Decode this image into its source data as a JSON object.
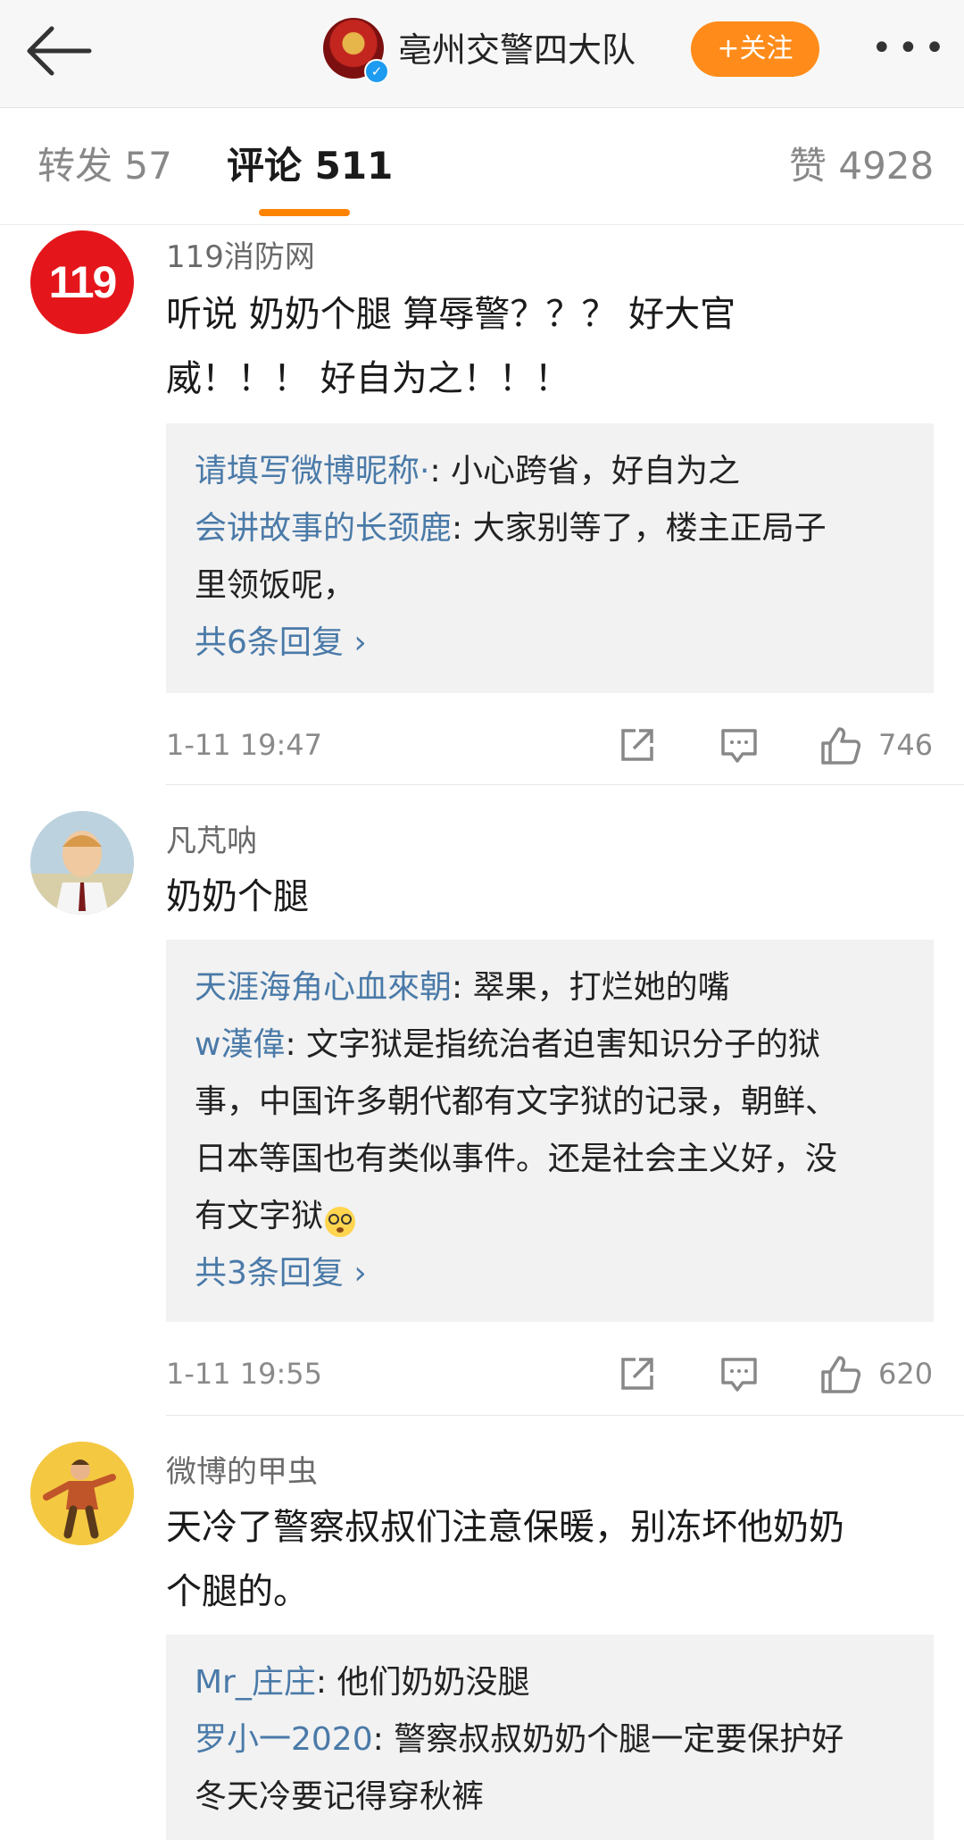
{
  "header": {
    "account_name": "亳州交警四大队",
    "follow_label": "+关注",
    "more_label": "•••"
  },
  "tabs": [
    {
      "label": "转发 57"
    },
    {
      "label": "评论 511"
    },
    {
      "label": "赞 4928"
    }
  ],
  "comments": [
    {
      "username": "119消防网",
      "avatar_text": "119",
      "content": [
        "听说 奶奶个腿 算辱警？？？ 好大官",
        "威！！！ 好自为之！！！"
      ],
      "replies": [
        {
          "name": "请填写微博昵称·",
          "text": ": 小心跨省，好自为之",
          "cont": ""
        },
        {
          "name": "会讲故事的长颈鹿",
          "text": ": 大家别等了，楼主正局子",
          "cont": "里领饭呢，"
        }
      ],
      "more_replies": "共6条回复 ›",
      "time": "1-11 19:47",
      "likes": "746"
    },
    {
      "username": "凡芃呐",
      "content": [
        "奶奶个腿"
      ],
      "replies": [
        {
          "name": "天涯海角心血來朝",
          "text": ": 翠果，打烂她的嘴"
        },
        {
          "name": "w漢偉",
          "text": ": 文字狱是指统治者迫害知识分子的狱",
          "cont": [
            "事，中国许多朝代都有文字狱的记录，朝鲜、",
            "日本等国也有类似事件。还是社会主义好，没",
            "有文字狱"
          ]
        }
      ],
      "more_replies": "共3条回复 ›",
      "time": "1-11 19:55",
      "likes": "620"
    },
    {
      "username": "微博的甲虫",
      "content": [
        "天冷了警察叔叔们注意保暖，别冻坏他奶奶",
        "个腿的。"
      ],
      "replies": [
        {
          "name": "Mr_庄庄",
          "text": ": 他们奶奶没腿"
        },
        {
          "name": "罗小一2020",
          "text": ": 警察叔叔奶奶个腿一定要保护好",
          "cont": "冬天冷要记得穿秋裤"
        }
      ]
    }
  ]
}
